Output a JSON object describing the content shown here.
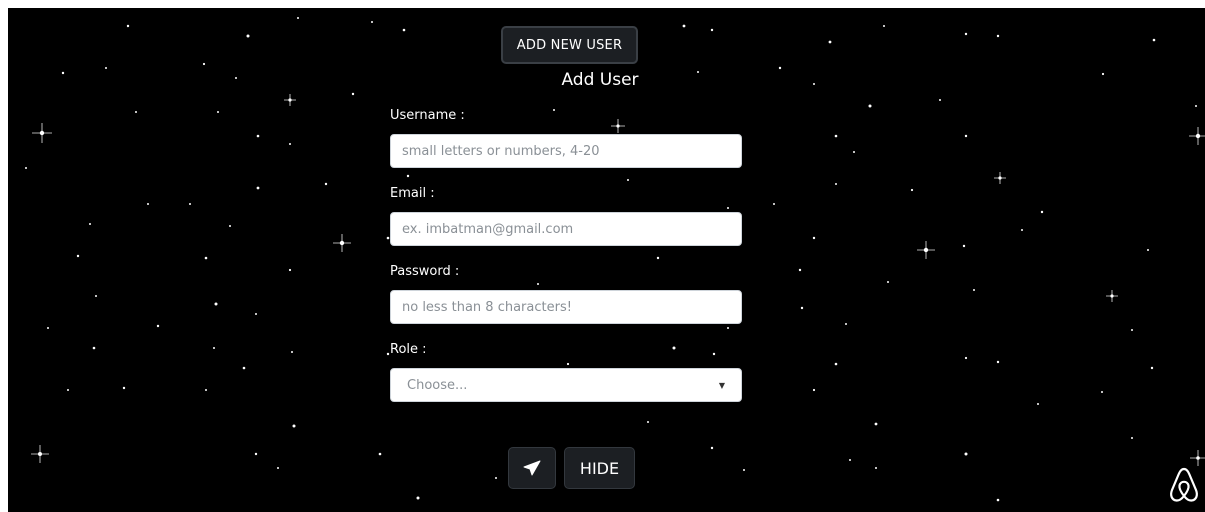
{
  "header": {
    "add_new_user_label": "ADD NEW USER"
  },
  "form": {
    "title": "Add User",
    "username": {
      "label": "Username :",
      "placeholder": "small letters or numbers, 4-20"
    },
    "email": {
      "label": "Email :",
      "placeholder": "ex. imbatman@gmail.com"
    },
    "password": {
      "label": "Password :",
      "placeholder": "no less than 8 characters!"
    },
    "role": {
      "label": "Role :",
      "selected": "Choose..."
    }
  },
  "actions": {
    "send_icon": "paper-plane-icon",
    "hide_label": "HIDE"
  },
  "branding": {
    "logo_icon": "airbnb-logo-icon"
  },
  "colors": {
    "background": "#000000",
    "button_bg": "#1c1f23",
    "text": "#ffffff"
  }
}
